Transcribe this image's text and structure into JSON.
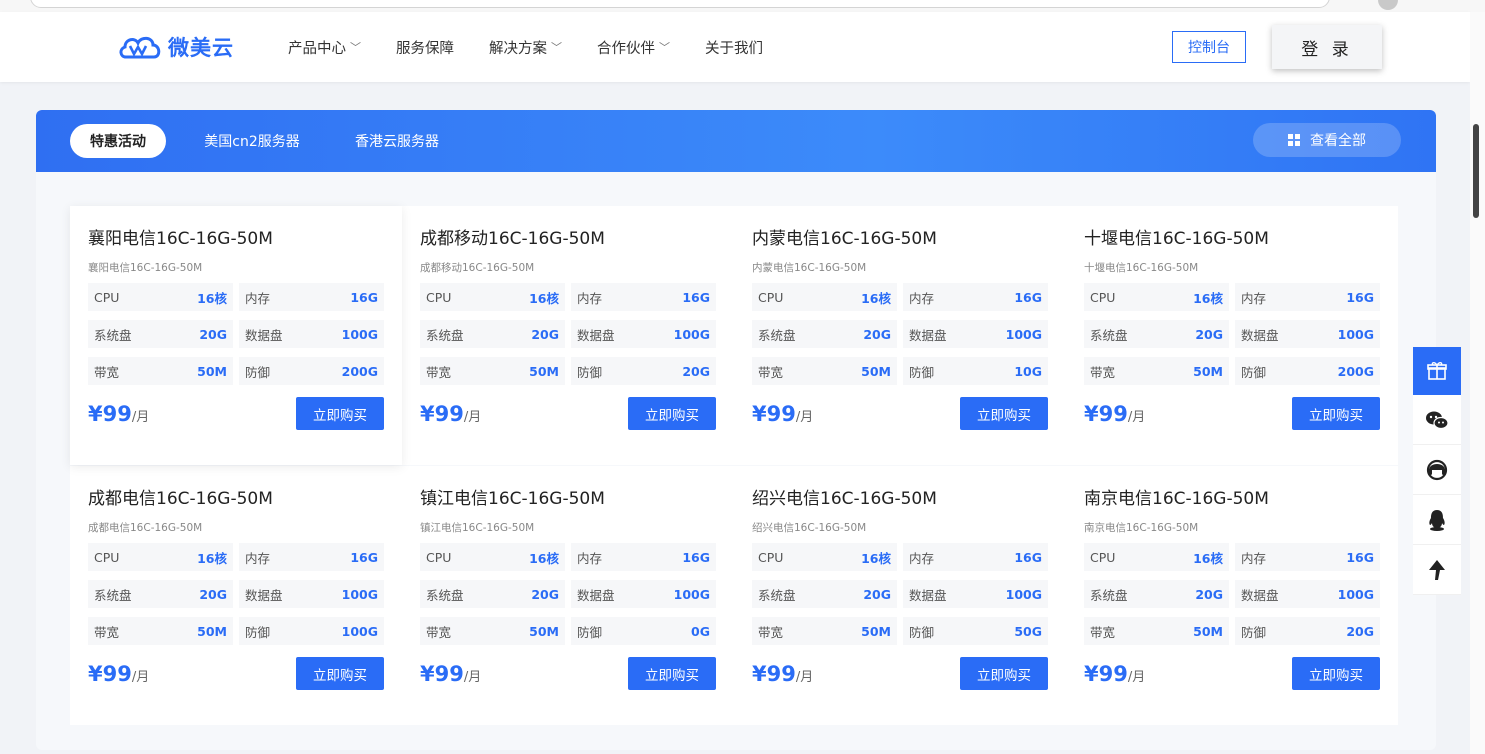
{
  "header": {
    "logo_text": "微美云",
    "nav": [
      {
        "label": "产品中心",
        "has_dropdown": true
      },
      {
        "label": "服务保障",
        "has_dropdown": false
      },
      {
        "label": "解决方案",
        "has_dropdown": true
      },
      {
        "label": "合作伙伴",
        "has_dropdown": true
      },
      {
        "label": "关于我们",
        "has_dropdown": false
      }
    ],
    "console_label": "控制台",
    "login_label": "登 录"
  },
  "tabs": [
    {
      "label": "特惠活动",
      "active": true
    },
    {
      "label": "美国cn2服务器",
      "active": false
    },
    {
      "label": "香港云服务器",
      "active": false
    }
  ],
  "view_all_label": "查看全部",
  "spec_labels": {
    "cpu": "CPU",
    "mem": "内存",
    "sys": "系统盘",
    "data": "数据盘",
    "bw": "带宽",
    "def": "防御"
  },
  "price_unit": "/月",
  "buy_label": "立即购买",
  "products": [
    {
      "title": "襄阳电信16C-16G-50M",
      "subtitle": "襄阳电信16C-16G-50M",
      "cpu": "16核",
      "mem": "16G",
      "sys": "20G",
      "data": "100G",
      "bw": "50M",
      "def": "200G",
      "price": "¥99"
    },
    {
      "title": "成都移动16C-16G-50M",
      "subtitle": "成都移动16C-16G-50M",
      "cpu": "16核",
      "mem": "16G",
      "sys": "20G",
      "data": "100G",
      "bw": "50M",
      "def": "20G",
      "price": "¥99"
    },
    {
      "title": "内蒙电信16C-16G-50M",
      "subtitle": "内蒙电信16C-16G-50M",
      "cpu": "16核",
      "mem": "16G",
      "sys": "20G",
      "data": "100G",
      "bw": "50M",
      "def": "10G",
      "price": "¥99"
    },
    {
      "title": "十堰电信16C-16G-50M",
      "subtitle": "十堰电信16C-16G-50M",
      "cpu": "16核",
      "mem": "16G",
      "sys": "20G",
      "data": "100G",
      "bw": "50M",
      "def": "200G",
      "price": "¥99"
    },
    {
      "title": "成都电信16C-16G-50M",
      "subtitle": "成都电信16C-16G-50M",
      "cpu": "16核",
      "mem": "16G",
      "sys": "20G",
      "data": "100G",
      "bw": "50M",
      "def": "100G",
      "price": "¥99"
    },
    {
      "title": "镇江电信16C-16G-50M",
      "subtitle": "镇江电信16C-16G-50M",
      "cpu": "16核",
      "mem": "16G",
      "sys": "20G",
      "data": "100G",
      "bw": "50M",
      "def": "0G",
      "price": "¥99"
    },
    {
      "title": "绍兴电信16C-16G-50M",
      "subtitle": "绍兴电信16C-16G-50M",
      "cpu": "16核",
      "mem": "16G",
      "sys": "20G",
      "data": "100G",
      "bw": "50M",
      "def": "50G",
      "price": "¥99"
    },
    {
      "title": "南京电信16C-16G-50M",
      "subtitle": "南京电信16C-16G-50M",
      "cpu": "16核",
      "mem": "16G",
      "sys": "20G",
      "data": "100G",
      "bw": "50M",
      "def": "20G",
      "price": "¥99"
    }
  ],
  "float_icons": [
    "gift-icon",
    "wechat-icon",
    "support-icon",
    "qq-icon",
    "back-to-top-icon"
  ],
  "colors": {
    "accent": "#2a6cf6"
  }
}
